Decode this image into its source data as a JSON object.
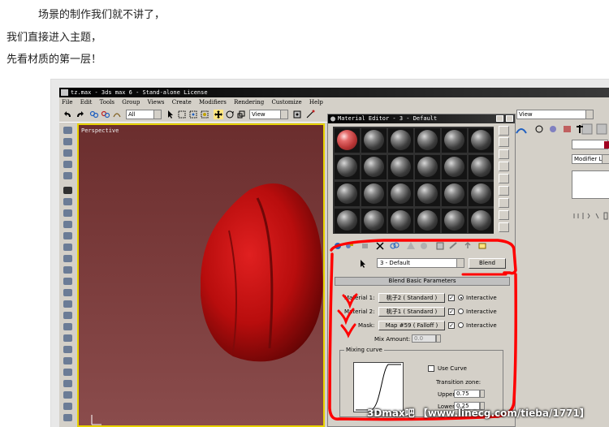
{
  "article": {
    "lines": [
      "场景的制作我们就不讲了，",
      "我们直接进入主题，",
      "先看材质的第一层！"
    ]
  },
  "app": {
    "title": "tz.max - 3ds max 6 - Stand-alone License",
    "menu": [
      "File",
      "Edit",
      "Tools",
      "Group",
      "Views",
      "Create",
      "Modifiers",
      "Rendering",
      "Customize",
      "Help"
    ],
    "selection_filter": "All",
    "ref_coord": "View",
    "ref_coord_right": "View",
    "viewport_label": "Perspective",
    "modifier_list": "Modifier List"
  },
  "material_editor": {
    "title": "Material Editor - 3 - Default",
    "material_name": "3 - Default",
    "material_type_button": "Blend",
    "rollout_title": "Blend Basic Parameters",
    "material1_label": "Material 1:",
    "material1_value": "桃子2 ( Standard )",
    "material2_label": "Material 2:",
    "material2_value": "桃子1 ( Standard )",
    "mask_label": "Mask:",
    "mask_value": "Map #59 ( Falloff )",
    "interactive_label": "Interactive",
    "mix_amount_label": "Mix Amount:",
    "mix_amount_value": "0.0",
    "mixing_curve_title": "Mixing curve",
    "use_curve_label": "Use Curve",
    "transition_zone_label": "Transition zone:",
    "upper_label": "Upper:",
    "upper_value": "0.75",
    "lower_label": "Lower:",
    "lower_value": "0.25",
    "material1_checked": true,
    "material2_checked": true,
    "mask_checked": true,
    "interactive_selected": "material1"
  },
  "watermark": "3Dmax吧 【www.linecg.com/tieba/1771】",
  "colors": {
    "annotation": "#ff0000",
    "peach": "#b80d0d",
    "viewport_border": "#e8d200"
  }
}
